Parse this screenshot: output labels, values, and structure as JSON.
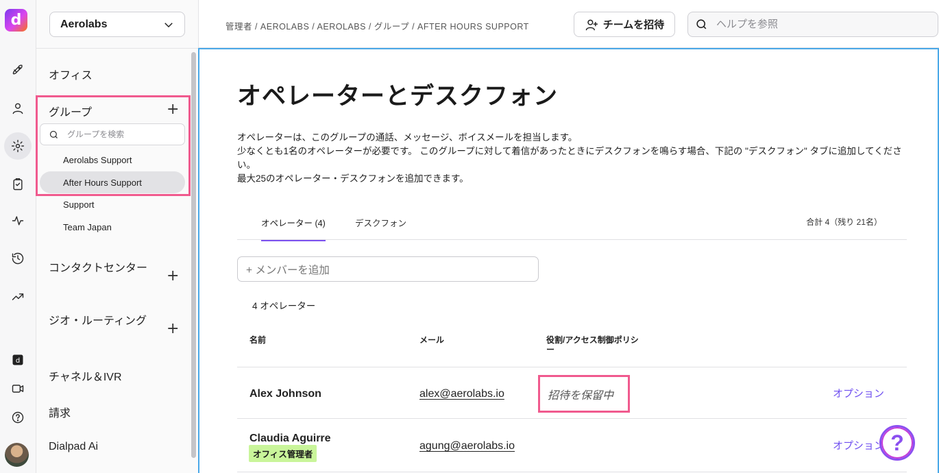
{
  "rail": {
    "logo_letter": "d",
    "icons": [
      "rocket-icon",
      "person-icon",
      "gear-icon",
      "clipboard-icon",
      "activity-icon",
      "history-icon",
      "trending-icon",
      "dialpad-ai-icon",
      "video-icon",
      "help-circle-icon"
    ]
  },
  "sidebar": {
    "org_name": "Aerolabs",
    "office": "オフィス",
    "groups_label": "グループ",
    "group_search_placeholder": "グループを検索",
    "groups": [
      "Aerolabs Support",
      "After Hours Support",
      "Support",
      "Team Japan"
    ],
    "contact_center": "コンタクトセンター",
    "geo_routing": "ジオ・ルーティング",
    "channels_ivr": "チャネル＆IVR",
    "billing": "請求",
    "dialpad_ai": "Dialpad Ai"
  },
  "header": {
    "breadcrumb": "管理者 / AEROLABS / AEROLABS / グループ / AFTER HOURS SUPPORT",
    "invite_label": "チームを招待",
    "help_placeholder": "ヘルプを参照"
  },
  "main": {
    "title": "オペレーターとデスクフォン",
    "desc1": "オペレーターは、このグループの通話、メッセージ、ボイスメールを担当します。",
    "desc2": "少なくとも1名のオペレーターが必要です。 このグループに対して着信があったときにデスクフォンを鳴らす場合、下記の \"デスクフォン\" タブに追加してください。",
    "desc3": "最大25のオペレーター・デスクフォンを追加できます。",
    "tabs": [
      {
        "label": "オペレーター (4)"
      },
      {
        "label": "デスクフォン"
      }
    ],
    "total": "合計 4（残り 21名）",
    "add_member_placeholder": "+ メンバーを追加",
    "count": "4 オペレーター",
    "columns": {
      "name": "名前",
      "email": "メール",
      "role": "役割/アクセス制御ポリシー"
    },
    "rows": [
      {
        "name": "Alex Johnson",
        "email": "alex@aerolabs.io",
        "status": "招待を保留中",
        "option": "オプション"
      },
      {
        "name": "Claudia Aguirre",
        "email": "agung@aerolabs.io",
        "badge": "オフィス管理者",
        "option": "オプション"
      }
    ],
    "help_fab": "?"
  },
  "colors": {
    "accent": "#7c52f0",
    "highlight": "#f05a8e",
    "focus_border": "#4aa8e8",
    "badge_bg": "#c9f59a"
  }
}
